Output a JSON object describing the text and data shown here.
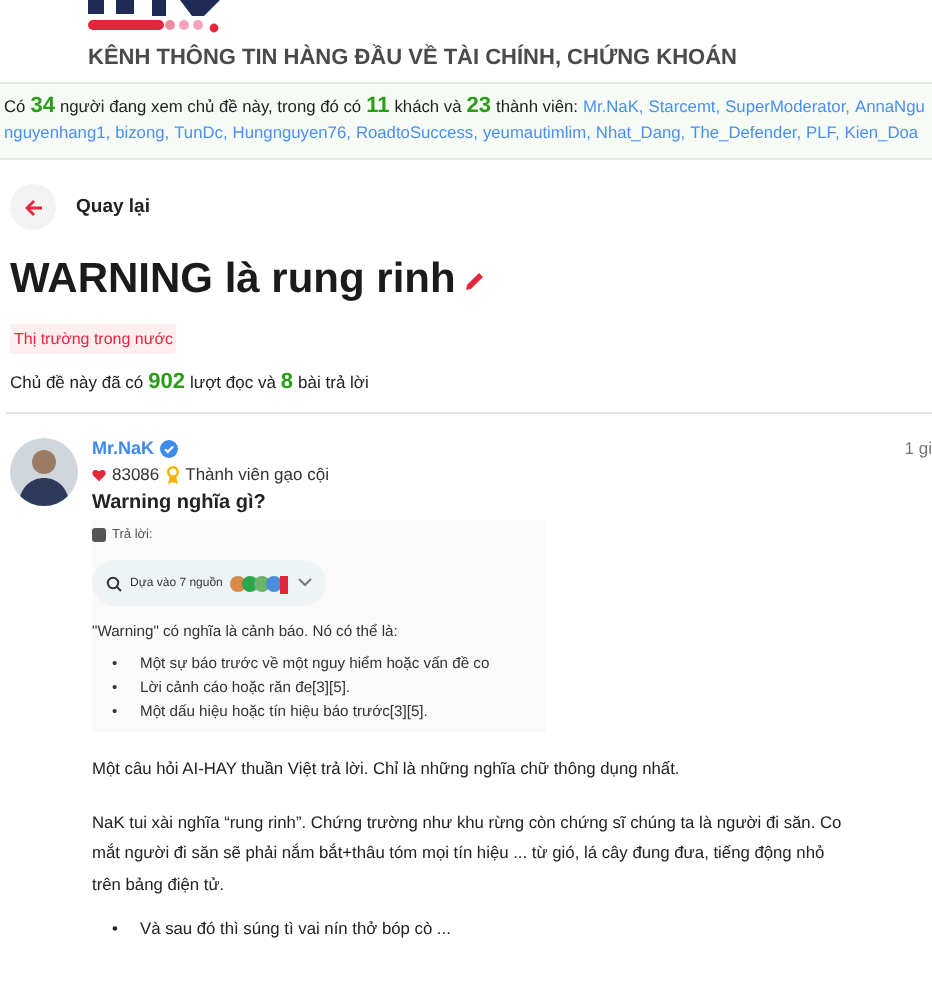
{
  "header": {
    "tagline": "KÊNH THÔNG TIN HÀNG ĐẦU VỀ TÀI CHÍNH, CHỨNG KHOÁN"
  },
  "online": {
    "prefix": "Có",
    "total": "34",
    "t1": "người đang xem chủ đề này, trong đó có",
    "guests": "11",
    "t2": "khách và",
    "members_count": "23",
    "t3": "thành viên:",
    "members": [
      "Mr.NaK,",
      "Starcemt,",
      "SuperModerator,",
      "AnnaNgu",
      "nguyenhang1,",
      "bizong,",
      "TunDc,",
      "Hungnguyen76,",
      "RoadtoSuccess,",
      "yeumautimlim,",
      "Nhat_Dang,",
      "The_Defender,",
      "PLF,",
      "Kien_Doa"
    ]
  },
  "back": {
    "label": "Quay lại"
  },
  "topic": {
    "title": "WARNING là rung rinh",
    "tag": "Thị trường trong nước"
  },
  "stats": {
    "t1": "Chủ đề này đã có",
    "views": "902",
    "t2": "lượt đọc và",
    "replies": "8",
    "t3": "bài trả lời"
  },
  "post": {
    "author": "Mr.NaK",
    "verified": true,
    "time": "1 gi",
    "likes": "83086",
    "rank": "Thành viên gạo cội",
    "question": "Warning nghĩa gì?",
    "answer_shot": {
      "label": "Trả lời:",
      "sources": "Dựa vào 7 nguồn",
      "intro": "\"Warning\" có nghĩa là cảnh báo. Nó có thể là:",
      "bullets": [
        {
          "marker": "•",
          "text": "Một sự báo trước về một nguy hiểm hoặc vấn đề co"
        },
        {
          "marker": "•",
          "text": "Lời cảnh cáo hoặc răn đe[3][5]."
        },
        {
          "marker": "•",
          "text": "Một dấu hiệu hoặc tín hiệu báo trước[3][5]."
        }
      ]
    },
    "p1": "Một câu hỏi AI-HAY thuần Việt trả lời. Chỉ là những nghĩa chữ thông dụng nhất.",
    "p2_lines": [
      "NaK tui xài nghĩa “rung rinh”. Chứng trường như khu rừng còn chứng sĩ chúng ta là người đi săn. Co",
      "mắt người đi săn sẽ phải nắm bắt+thâu tóm mọi tín hiệu ... từ gió, lá cây đung đưa, tiếng động nhỏ",
      "trên bảng điện tử."
    ],
    "bullets": [
      {
        "marker": "•",
        "text": "Và sau đó thì súng tì vai nín thở bóp cò ..."
      }
    ]
  }
}
